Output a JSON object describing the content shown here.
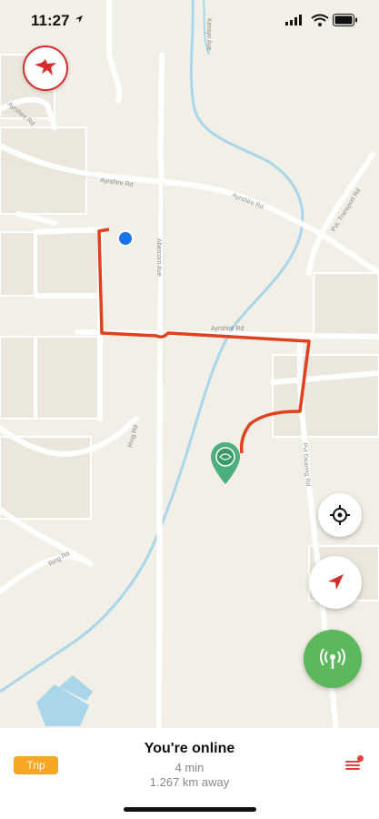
{
  "status_bar": {
    "time": "11:27"
  },
  "map": {
    "route_color": "#e0401e",
    "road_labels": {
      "ayrshire_rd_1": "Ayrshire Rd",
      "ayrshire_rd_2": "Ayrshire Rd",
      "ayrshire_rd_3": "Ayrshire Rd",
      "abercorn_ave": "Abercorn Ave",
      "ring_rd_1": "Ring Rd",
      "ring_rd_2": "Ring Rd",
      "pvt_dearing_rd": "Pvt Dearing Rd",
      "pvt_transport_rd": "Pvt. Transport Rd",
      "corner_left": "Ayrshire Rd",
      "top_avenue": "Kerayo Ave"
    }
  },
  "controls": {
    "recenter_icon": "crosshair-icon",
    "navigate_icon": "navigation-arrow-icon",
    "broadcast_icon": "broadcast-icon",
    "broadcast_color": "#5cb85c"
  },
  "bottom_panel": {
    "trip_label": "Trip",
    "status": "You're online",
    "eta": "4 min",
    "distance": "1.267 km away"
  }
}
